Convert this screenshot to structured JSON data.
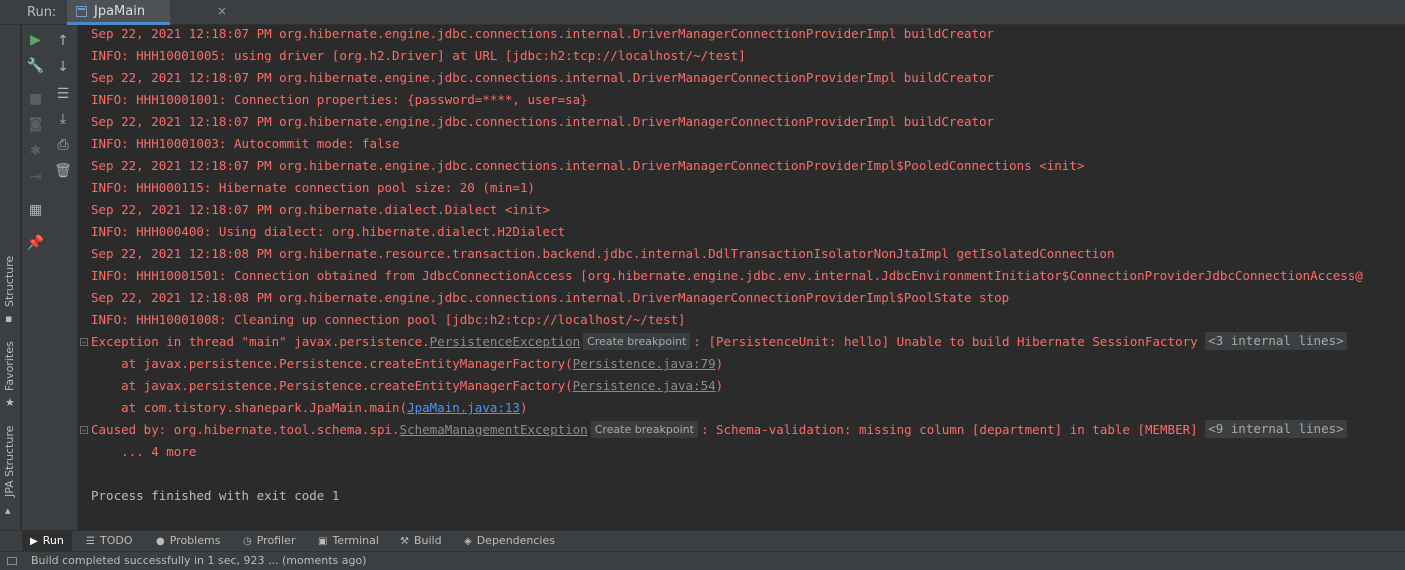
{
  "window": {
    "run_label": "Run:",
    "tab_label": "JpaMain",
    "tab_close": "×",
    "tab_icon": "console-window-icon"
  },
  "side_tabs": {
    "structure": "Structure",
    "favorites": "Favorites",
    "jpa_structure": "JPA Structure"
  },
  "toolbar": {
    "run": "▶",
    "wrench": "🔧",
    "stop": "■",
    "camera": "◙",
    "settings": "✱",
    "exit": "⇥",
    "layout": "▦",
    "pin": "📌",
    "up": "↑",
    "down": "↓",
    "soft_wrap": "☰",
    "scroll_end": "⤓",
    "print": "⎙",
    "trash": "🗑"
  },
  "console": {
    "lines": [
      "Sep 22, 2021 12:18:07 PM org.hibernate.engine.jdbc.connections.internal.DriverManagerConnectionProviderImpl buildCreator",
      "INFO: HHH10001005: using driver [org.h2.Driver] at URL [jdbc:h2:tcp://localhost/~/test]",
      "Sep 22, 2021 12:18:07 PM org.hibernate.engine.jdbc.connections.internal.DriverManagerConnectionProviderImpl buildCreator",
      "INFO: HHH10001001: Connection properties: {password=****, user=sa}",
      "Sep 22, 2021 12:18:07 PM org.hibernate.engine.jdbc.connections.internal.DriverManagerConnectionProviderImpl buildCreator",
      "INFO: HHH10001003: Autocommit mode: false",
      "Sep 22, 2021 12:18:07 PM org.hibernate.engine.jdbc.connections.internal.DriverManagerConnectionProviderImpl$PooledConnections <init>",
      "INFO: HHH000115: Hibernate connection pool size: 20 (min=1)",
      "Sep 22, 2021 12:18:07 PM org.hibernate.dialect.Dialect <init>",
      "INFO: HHH000400: Using dialect: org.hibernate.dialect.H2Dialect",
      "Sep 22, 2021 12:18:08 PM org.hibernate.resource.transaction.backend.jdbc.internal.DdlTransactionIsolatorNonJtaImpl getIsolatedConnection",
      "INFO: HHH10001501: Connection obtained from JdbcConnectionAccess [org.hibernate.engine.jdbc.env.internal.JdbcEnvironmentInitiator$ConnectionProviderJdbcConnectionAccess@",
      "Sep 22, 2021 12:18:08 PM org.hibernate.engine.jdbc.connections.internal.DriverManagerConnectionProviderImpl$PoolState stop",
      "INFO: HHH10001008: Cleaning up connection pool [jdbc:h2:tcp://localhost/~/test]"
    ],
    "exception": {
      "prefix": "Exception in thread \"main\" javax.persistence.",
      "link": "PersistenceException",
      "breakpoint": "Create breakpoint",
      "message": ": [PersistenceUnit: hello] Unable to build Hibernate SessionFactory",
      "internal": "<3 internal lines>"
    },
    "stack": [
      {
        "prefix": "    at javax.persistence.Persistence.createEntityManagerFactory(",
        "link": "Persistence.java:79",
        "suffix": ")"
      },
      {
        "prefix": "    at javax.persistence.Persistence.createEntityManagerFactory(",
        "link": "Persistence.java:54",
        "suffix": ")"
      },
      {
        "prefix": "    at com.tistory.shanepark.JpaMain.main(",
        "link": "JpaMain.java:13",
        "suffix": ")"
      }
    ],
    "caused": {
      "prefix": "Caused by: org.hibernate.tool.schema.spi.",
      "link": "SchemaManagementException",
      "breakpoint": "Create breakpoint",
      "message": ": Schema-validation: missing column [department] in table [MEMBER]",
      "internal": "<9 internal lines>"
    },
    "more": "    ... 4 more",
    "exit": "Process finished with exit code 1"
  },
  "bottom_tabs": {
    "run": "Run",
    "todo": "TODO",
    "problems": "Problems",
    "profiler": "Profiler",
    "terminal": "Terminal",
    "build": "Build",
    "dependencies": "Dependencies"
  },
  "status": {
    "text": "Build completed successfully in 1 sec, 923 ... (moments ago)"
  }
}
